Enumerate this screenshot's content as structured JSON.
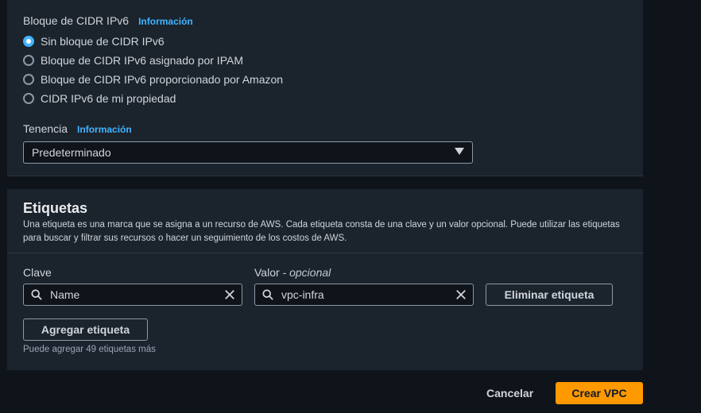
{
  "ipv6_cidr": {
    "label": "Bloque de CIDR IPv6",
    "info": "Información",
    "options": [
      {
        "label": "Sin bloque de CIDR IPv6",
        "selected": true
      },
      {
        "label": "Bloque de CIDR IPv6 asignado por IPAM",
        "selected": false
      },
      {
        "label": "Bloque de CIDR IPv6 proporcionado por Amazon",
        "selected": false
      },
      {
        "label": "CIDR IPv6 de mi propiedad",
        "selected": false
      }
    ]
  },
  "tenancy": {
    "label": "Tenencia",
    "info": "Información",
    "selected": "Predeterminado"
  },
  "tags": {
    "title": "Etiquetas",
    "description": "Una etiqueta es una marca que se asigna a un recurso de AWS. Cada etiqueta consta de una clave y un valor opcional. Puede utilizar las etiquetas para buscar y filtrar sus recursos o hacer un seguimiento de los costos de AWS.",
    "key_label": "Clave",
    "value_label": "Valor",
    "value_optional": "- opcional",
    "rows": [
      {
        "key": "Name",
        "value": "vpc-infra"
      }
    ],
    "remove_button": "Eliminar etiqueta",
    "add_button": "Agregar etiqueta",
    "hint": "Puede agregar 49 etiquetas más"
  },
  "footer": {
    "cancel": "Cancelar",
    "create": "Crear VPC"
  },
  "colors": {
    "accent": "#42b4ff",
    "primary_button": "#ff9900",
    "panel": "#1b232d",
    "background": "#0f141a"
  },
  "icons": [
    "search-icon",
    "clear-icon",
    "caret-down-icon"
  ]
}
